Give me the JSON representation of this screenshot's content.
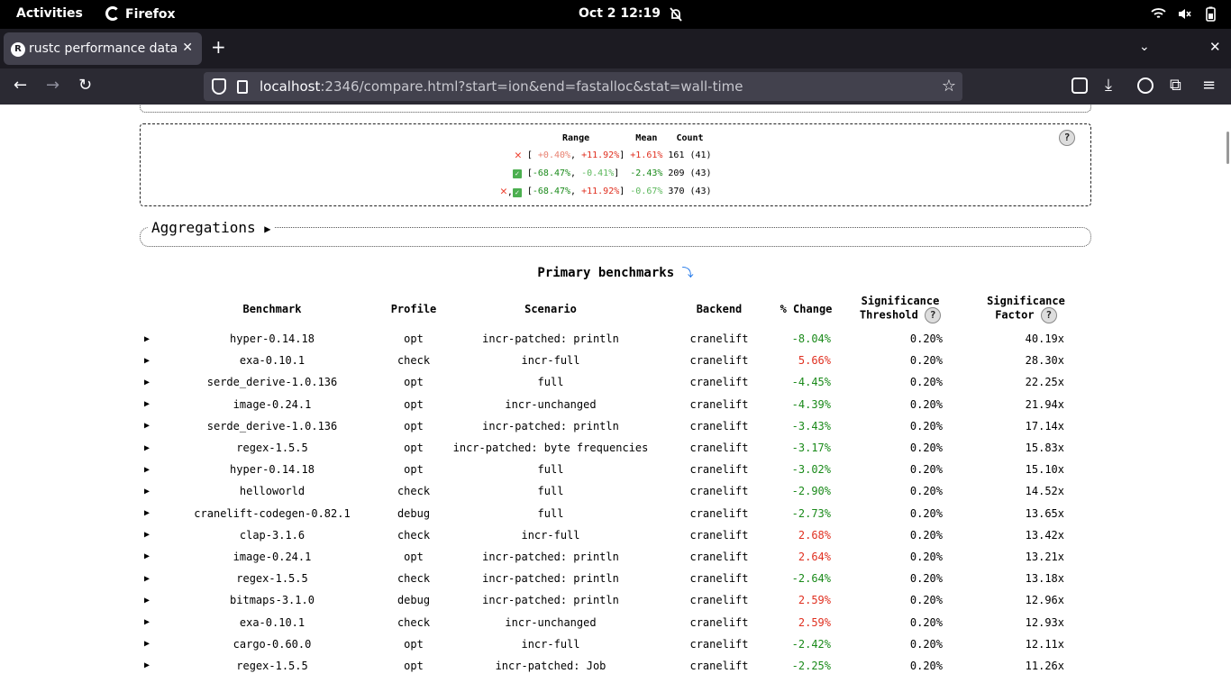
{
  "system": {
    "activities": "Activities",
    "app_name": "Firefox",
    "clock": "Oct 2  12:19"
  },
  "browser": {
    "tab_title": "rustc performance data",
    "url_host": "localhost",
    "url_rest": ":2346/compare.html?start=ion&end=fastalloc&stat=wall-time"
  },
  "summary": {
    "headers": [
      "Range",
      "Mean",
      "Count"
    ],
    "rows": [
      {
        "range_lo": "+0.40%",
        "range_hi": "+11.92%",
        "mean": "+1.61%",
        "count": "161 (41)"
      },
      {
        "range_lo": "-68.47%",
        "range_hi": "-0.41%",
        "mean": "-2.43%",
        "count": "209 (43)"
      },
      {
        "range_lo": "-68.47%",
        "range_hi": "+11.92%",
        "mean": "-0.67%",
        "count": "370 (43)"
      }
    ],
    "help": "?"
  },
  "aggregations": {
    "label": "Aggregations",
    "toggle": "▶"
  },
  "primary": {
    "title": "Primary benchmarks",
    "columns": {
      "benchmark": "Benchmark",
      "profile": "Profile",
      "scenario": "Scenario",
      "backend": "Backend",
      "change": "% Change",
      "threshold_1": "Significance",
      "threshold_2": "Threshold",
      "factor_1": "Significance",
      "factor_2": "Factor"
    },
    "rows": [
      {
        "benchmark": "hyper-0.14.18",
        "profile": "opt",
        "scenario": "incr-patched: println",
        "backend": "cranelift",
        "change": "-8.04%",
        "threshold": "0.20%",
        "factor": "40.19x"
      },
      {
        "benchmark": "exa-0.10.1",
        "profile": "check",
        "scenario": "incr-full",
        "backend": "cranelift",
        "change": "5.66%",
        "threshold": "0.20%",
        "factor": "28.30x"
      },
      {
        "benchmark": "serde_derive-1.0.136",
        "profile": "opt",
        "scenario": "full",
        "backend": "cranelift",
        "change": "-4.45%",
        "threshold": "0.20%",
        "factor": "22.25x"
      },
      {
        "benchmark": "image-0.24.1",
        "profile": "opt",
        "scenario": "incr-unchanged",
        "backend": "cranelift",
        "change": "-4.39%",
        "threshold": "0.20%",
        "factor": "21.94x"
      },
      {
        "benchmark": "serde_derive-1.0.136",
        "profile": "opt",
        "scenario": "incr-patched: println",
        "backend": "cranelift",
        "change": "-3.43%",
        "threshold": "0.20%",
        "factor": "17.14x"
      },
      {
        "benchmark": "regex-1.5.5",
        "profile": "opt",
        "scenario": "incr-patched: byte frequencies",
        "backend": "cranelift",
        "change": "-3.17%",
        "threshold": "0.20%",
        "factor": "15.83x"
      },
      {
        "benchmark": "hyper-0.14.18",
        "profile": "opt",
        "scenario": "full",
        "backend": "cranelift",
        "change": "-3.02%",
        "threshold": "0.20%",
        "factor": "15.10x"
      },
      {
        "benchmark": "helloworld",
        "profile": "check",
        "scenario": "full",
        "backend": "cranelift",
        "change": "-2.90%",
        "threshold": "0.20%",
        "factor": "14.52x"
      },
      {
        "benchmark": "cranelift-codegen-0.82.1",
        "profile": "debug",
        "scenario": "full",
        "backend": "cranelift",
        "change": "-2.73%",
        "threshold": "0.20%",
        "factor": "13.65x"
      },
      {
        "benchmark": "clap-3.1.6",
        "profile": "check",
        "scenario": "incr-full",
        "backend": "cranelift",
        "change": "2.68%",
        "threshold": "0.20%",
        "factor": "13.42x"
      },
      {
        "benchmark": "image-0.24.1",
        "profile": "opt",
        "scenario": "incr-patched: println",
        "backend": "cranelift",
        "change": "2.64%",
        "threshold": "0.20%",
        "factor": "13.21x"
      },
      {
        "benchmark": "regex-1.5.5",
        "profile": "check",
        "scenario": "incr-patched: println",
        "backend": "cranelift",
        "change": "-2.64%",
        "threshold": "0.20%",
        "factor": "13.18x"
      },
      {
        "benchmark": "bitmaps-3.1.0",
        "profile": "debug",
        "scenario": "incr-patched: println",
        "backend": "cranelift",
        "change": "2.59%",
        "threshold": "0.20%",
        "factor": "12.96x"
      },
      {
        "benchmark": "exa-0.10.1",
        "profile": "check",
        "scenario": "incr-unchanged",
        "backend": "cranelift",
        "change": "2.59%",
        "threshold": "0.20%",
        "factor": "12.93x"
      },
      {
        "benchmark": "cargo-0.60.0",
        "profile": "opt",
        "scenario": "incr-full",
        "backend": "cranelift",
        "change": "-2.42%",
        "threshold": "0.20%",
        "factor": "12.11x"
      },
      {
        "benchmark": "regex-1.5.5",
        "profile": "opt",
        "scenario": "incr-patched: Job",
        "backend": "cranelift",
        "change": "-2.25%",
        "threshold": "0.20%",
        "factor": "11.26x"
      }
    ]
  }
}
